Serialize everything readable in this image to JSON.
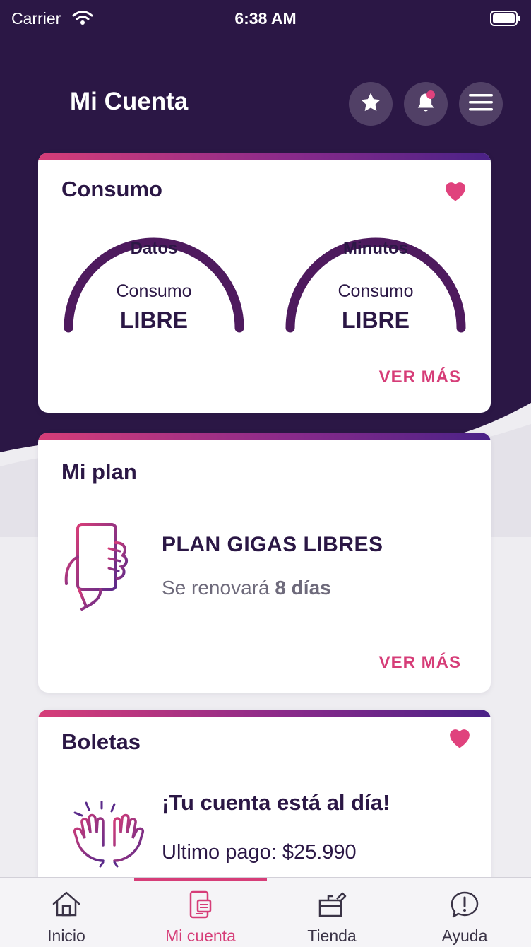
{
  "status_bar": {
    "carrier": "Carrier",
    "time": "6:38 AM"
  },
  "header": {
    "title": "Mi Cuenta"
  },
  "cards": {
    "consumo": {
      "title": "Consumo",
      "gauges": [
        {
          "label": "Datos",
          "sublabel": "Consumo",
          "value": "LIBRE"
        },
        {
          "label": "Minutos",
          "sublabel": "Consumo",
          "value": "LIBRE"
        }
      ],
      "ver_mas": "VER MÁS"
    },
    "plan": {
      "title": "Mi plan",
      "plan_name": "PLAN GIGAS LIBRES",
      "renew_prefix": "Se renovará",
      "renew_days": "8 días",
      "ver_mas": "VER MÁS"
    },
    "boletas": {
      "title": "Boletas",
      "status": "¡Tu cuenta está al día!",
      "last_payment": "Ultimo pago: $25.990"
    }
  },
  "tabbar": {
    "tabs": [
      {
        "label": "Inicio",
        "icon": "home-icon"
      },
      {
        "label": "Mi cuenta",
        "icon": "phone-account-icon"
      },
      {
        "label": "Tienda",
        "icon": "store-icon"
      },
      {
        "label": "Ayuda",
        "icon": "help-icon"
      }
    ],
    "active_index": 1
  },
  "colors": {
    "brand_dark": "#2b1745",
    "accent_pink": "#d63d78",
    "gradient_purple": "#4a2287"
  }
}
